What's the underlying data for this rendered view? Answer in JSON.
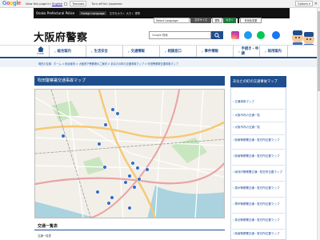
{
  "translate_bar": {
    "text_prefix": "View this page in:",
    "language": "English",
    "translate_button": "Translate",
    "turn_off_text": "Turn off for: Japanese",
    "options": "Options ▾",
    "close": "✕"
  },
  "header": {
    "site_name": "Osaka Prefectural Police",
    "foreign_language": "Foreign Language",
    "font_size": "文字を大きく 大きく 標準",
    "select_language": "Select Language",
    "btn_moji": "文字サイズ",
    "btn_std": "標準",
    "btn_large": "大きく",
    "btn_color": "背景色変更",
    "logo": "大阪府警察",
    "search_placeholder": "Google 検索"
  },
  "nav": {
    "home_label": "HOME",
    "items": [
      "総合案内",
      "生活安全",
      "交通情報",
      "相談窓口",
      "事件情報",
      "手続き・申請",
      "採用案内"
    ]
  },
  "breadcrumb": "現在の位置：ホーム > 総合案内 > 大阪府下警察署のご案内 > あなたの町の交通事故マップ > 吹田警察署交通事故マップ",
  "main": {
    "page_title": "吹田警察署交通事故マップ",
    "list_title": "交通一覧表",
    "list_sub": "交通一覧表"
  },
  "sidebar": {
    "title": "あなたの町の交通事故マップ",
    "items": [
      "交通事故マップ",
      "大阪市内の交通一覧",
      "大阪市内の交通一覧",
      "阪東警察署交通・駐在所位置マップ",
      "阪南警察署交通・駐在所位置マップ",
      "南河内警察署交通・駐在所位置マップ",
      "泉州警察署交通・駐在所位置マップ",
      "堺市警察署交通・駐在所位置マップ",
      "泉北警察署交通・駐在所位置マップ",
      "阪南警察署交通・駐在所位置マップ"
    ]
  },
  "colors": {
    "brand_blue": "#1f4e8c",
    "map_bg": "#f2efe9",
    "marker": "#3a6fc4"
  }
}
